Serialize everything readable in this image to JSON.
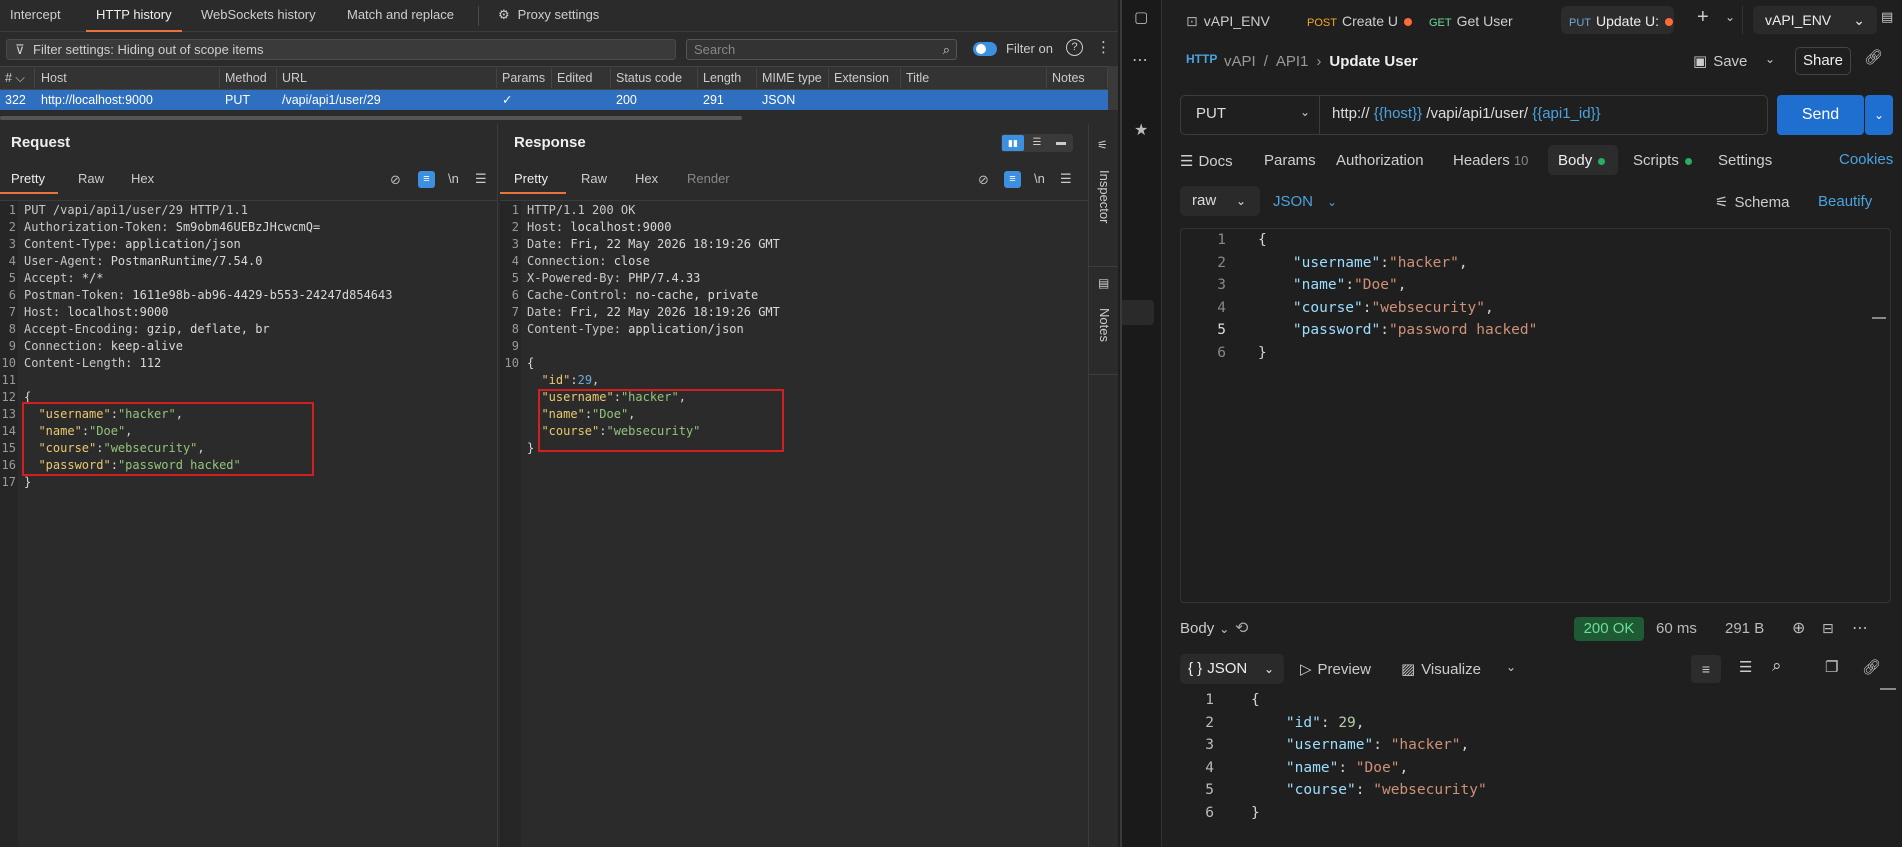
{
  "burp": {
    "top_tabs": [
      "Intercept",
      "HTTP history",
      "WebSockets history",
      "Match and replace",
      "Proxy settings"
    ],
    "filter_text": "Filter settings: Hiding out of scope items",
    "search_placeholder": "Search",
    "filter_on_label": "Filter on",
    "columns": [
      "#",
      "Host",
      "Method",
      "URL",
      "Params",
      "Edited",
      "Status code",
      "Length",
      "MIME type",
      "Extension",
      "Title",
      "Notes"
    ],
    "row": {
      "num": "322",
      "host": "http://localhost:9000",
      "method": "PUT",
      "url": "/vapi/api1/user/29",
      "params": "✓",
      "status": "200",
      "length": "291",
      "mime": "JSON"
    },
    "request": {
      "title": "Request",
      "tabs": [
        "Pretty",
        "Raw",
        "Hex"
      ],
      "newline_label": "\\n",
      "line_numbers": "1\n2\n3\n4\n5\n6\n7\n8\n9\n10\n11\n12\n13\n14\n15\n16\n17",
      "headers": [
        {
          "k": "PUT /vapi/api1/user/29 HTTP/1.1",
          "v": ""
        },
        {
          "k": "Authorization-Token:",
          "v": " Sm9obm46UEBzJHcwcmQ="
        },
        {
          "k": "Content-Type:",
          "v": " application/json"
        },
        {
          "k": "User-Agent:",
          "v": " PostmanRuntime/7.54.0"
        },
        {
          "k": "Accept:",
          "v": " */*"
        },
        {
          "k": "Postman-Token:",
          "v": " 1611e98b-ab96-4429-b553-24247d854643"
        },
        {
          "k": "Host:",
          "v": " localhost:9000"
        },
        {
          "k": "Accept-Encoding:",
          "v": " gzip, deflate, br"
        },
        {
          "k": "Connection:",
          "v": " keep-alive"
        },
        {
          "k": "Content-Length:",
          "v": " 112"
        }
      ],
      "body_open": "{",
      "body": [
        {
          "k": "\"username\"",
          "v": "\"hacker\"",
          "end": ","
        },
        {
          "k": "\"name\"",
          "v": "\"Doe\"",
          "end": ","
        },
        {
          "k": "\"course\"",
          "v": "\"websecurity\"",
          "end": ","
        },
        {
          "k": "\"password\"",
          "v": "\"password hacked\"",
          "end": ""
        }
      ],
      "body_close": "}"
    },
    "response": {
      "title": "Response",
      "tabs": [
        "Pretty",
        "Raw",
        "Hex",
        "Render"
      ],
      "newline_label": "\\n",
      "line_numbers": "1\n2\n3\n4\n5\n6\n7\n8\n9\n10",
      "headers": [
        {
          "k": "HTTP/1.1 200 OK",
          "v": ""
        },
        {
          "k": "Host:",
          "v": " localhost:9000"
        },
        {
          "k": "Date:",
          "v": " Fri, 22 May 2026 18:19:26 GMT"
        },
        {
          "k": "Connection:",
          "v": " close"
        },
        {
          "k": "X-Powered-By:",
          "v": " PHP/7.4.33"
        },
        {
          "k": "Cache-Control:",
          "v": " no-cache, private"
        },
        {
          "k": "Date:",
          "v": " Fri, 22 May 2026 18:19:26 GMT"
        },
        {
          "k": "Content-Type:",
          "v": " application/json"
        }
      ],
      "body_open": "{",
      "id_key": "\"id\"",
      "id_val": "29",
      "body": [
        {
          "k": "\"username\"",
          "v": "\"hacker\"",
          "end": ","
        },
        {
          "k": "\"name\"",
          "v": "\"Doe\"",
          "end": ","
        },
        {
          "k": "\"course\"",
          "v": "\"websecurity\"",
          "end": ""
        }
      ],
      "body_close": "}"
    },
    "side_tabs": [
      "Inspector",
      "Notes"
    ]
  },
  "postman": {
    "tabs": [
      {
        "method": "",
        "label": "vAPI_ENV"
      },
      {
        "method": "POST",
        "label": "Create U"
      },
      {
        "method": "GET",
        "label": "Get User"
      },
      {
        "method": "PUT",
        "label": "Update U:"
      }
    ],
    "env": "vAPI_ENV",
    "breadcrumb": [
      "vAPI",
      "API1"
    ],
    "title": "Update User",
    "http_badge": "HTTP",
    "save_label": "Save",
    "share_label": "Share",
    "method": "PUT",
    "url_prefix": "http://",
    "url_var1": "{{host}}",
    "url_mid": "/vapi/api1/user/",
    "url_var2": "{{api1_id}}",
    "send_label": "Send",
    "subtabs": [
      "Docs",
      "Params",
      "Authorization",
      "Headers",
      "Body",
      "Scripts",
      "Settings"
    ],
    "headers_count": "10",
    "cookies_label": "Cookies",
    "body_mode": "raw",
    "body_lang": "JSON",
    "schema_label": "Schema",
    "beautify_label": "Beautify",
    "req_line_numbers": [
      "1",
      "2",
      "3",
      "4",
      "5",
      "6"
    ],
    "req_body": [
      {
        "k": "",
        "v": "{",
        "end": ""
      },
      {
        "k": "\"username\"",
        "v": "\"hacker\"",
        "end": ","
      },
      {
        "k": "\"name\"",
        "v": "\"Doe\"",
        "end": ","
      },
      {
        "k": "\"course\"",
        "v": "\"websecurity\"",
        "end": ","
      },
      {
        "k": "\"password\"",
        "v": "\"password hacked\"",
        "end": ""
      },
      {
        "k": "",
        "v": "}",
        "end": ""
      }
    ],
    "resp_label": "Body",
    "status": "200 OK",
    "time": "60 ms",
    "size": "291 B",
    "resp_format": "JSON",
    "preview_label": "Preview",
    "visualize_label": "Visualize",
    "resp_line_numbers": [
      "1",
      "2",
      "3",
      "4",
      "5",
      "6"
    ],
    "resp_id_key": "\"id\"",
    "resp_id_val": "29",
    "resp_body": [
      {
        "k": "\"username\"",
        "v": "\"hacker\"",
        "end": ","
      },
      {
        "k": "\"name\"",
        "v": "\"Doe\"",
        "end": ","
      },
      {
        "k": "\"course\"",
        "v": "\"websecurity\"",
        "end": ""
      }
    ]
  }
}
